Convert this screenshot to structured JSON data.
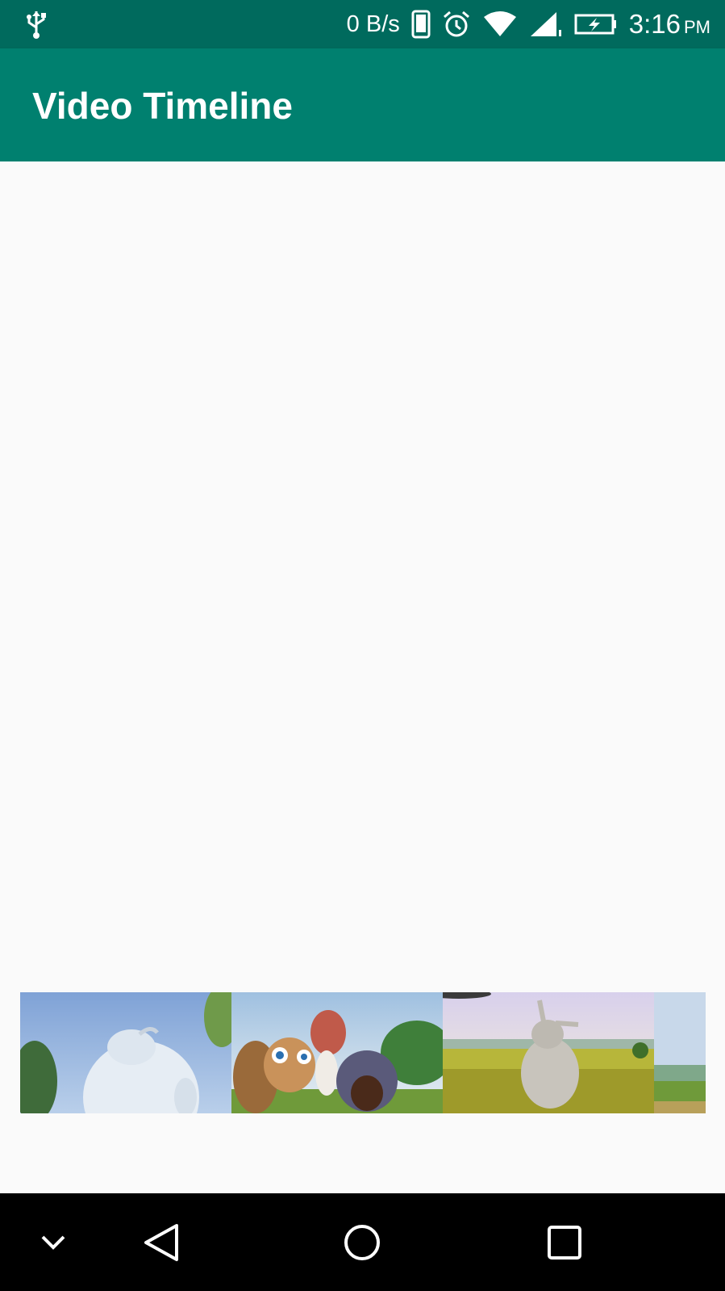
{
  "status_bar": {
    "net_speed": "0 B/s",
    "time": "3:16",
    "ampm": "PM",
    "icons": [
      "usb-icon",
      "phone-icon",
      "alarm-icon",
      "wifi-icon",
      "signal-icon",
      "battery-charging-icon"
    ]
  },
  "app_bar": {
    "title": "Video Timeline",
    "color": "#00806f",
    "status_color": "#006a5d"
  },
  "timeline": {
    "frames": [
      "frame-1",
      "frame-2",
      "frame-3",
      "frame-4"
    ]
  },
  "nav_bar": {
    "icons": [
      "hide-keyboard-icon",
      "back-icon",
      "home-icon",
      "recents-icon"
    ]
  }
}
